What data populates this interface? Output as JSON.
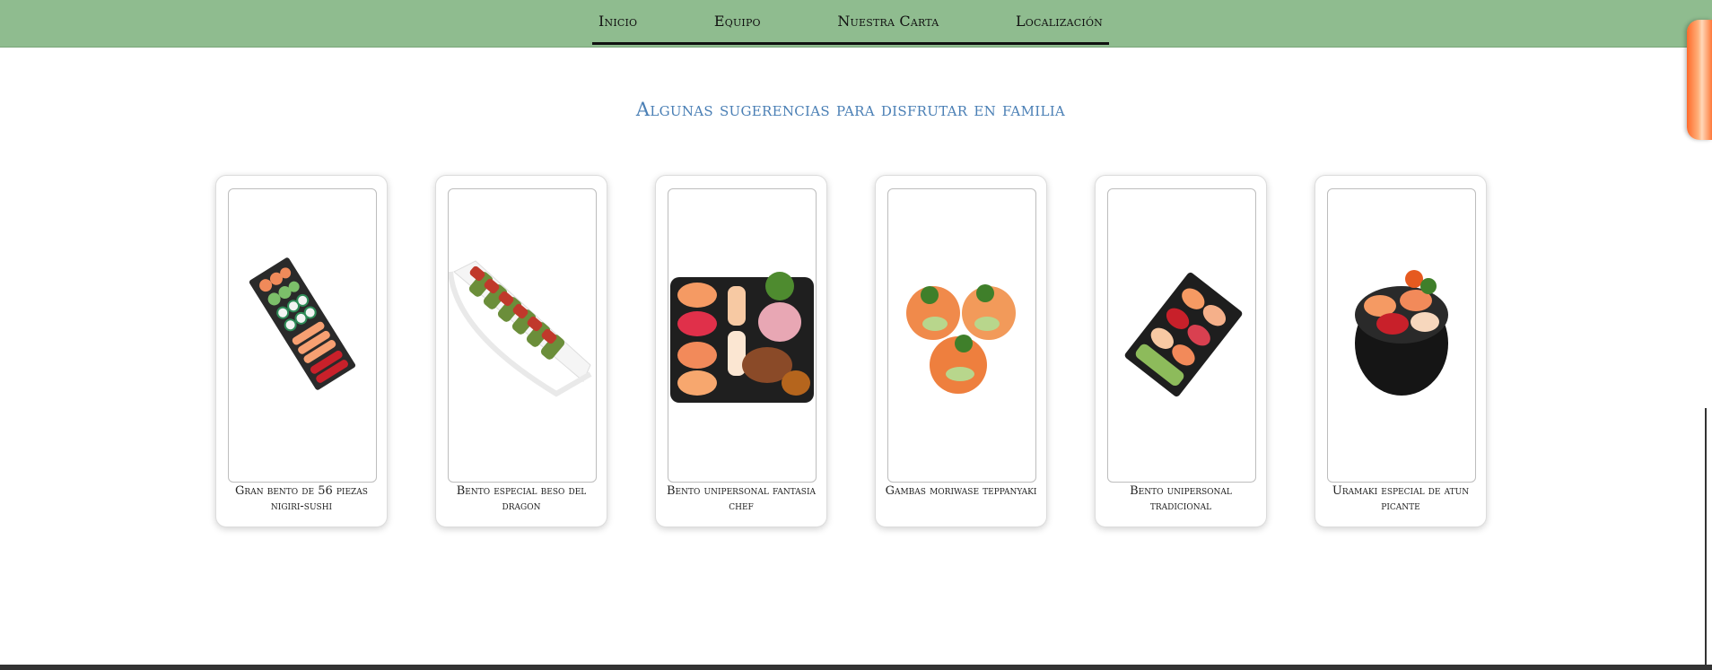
{
  "nav": {
    "items": [
      {
        "label": "Inicio"
      },
      {
        "label": "Equipo"
      },
      {
        "label": "Nuestra Carta"
      },
      {
        "label": "Localización"
      }
    ]
  },
  "main": {
    "title": "Algunas sugerencias para disfrutar en familia",
    "cards": [
      {
        "caption": "Gran bento de 56 piezas nigiri-sushi",
        "image_icon": "bento-tray-image"
      },
      {
        "caption": "Bento especial beso del dragon",
        "image_icon": "dragon-roll-image"
      },
      {
        "caption": "Bento unipersonal fantasia chef",
        "image_icon": "chef-bento-image"
      },
      {
        "caption": "Gambas moriwase teppanyaki",
        "image_icon": "shrimp-image"
      },
      {
        "caption": "Bento unipersonal tradicional",
        "image_icon": "traditional-bento-image"
      },
      {
        "caption": "Uramaki especial de atun picante",
        "image_icon": "sushi-bowl-image"
      }
    ]
  },
  "colors": {
    "nav_bg": "#8fbc8f",
    "title": "#4a7fb5",
    "accent_scroll": "#ff6a2a"
  }
}
